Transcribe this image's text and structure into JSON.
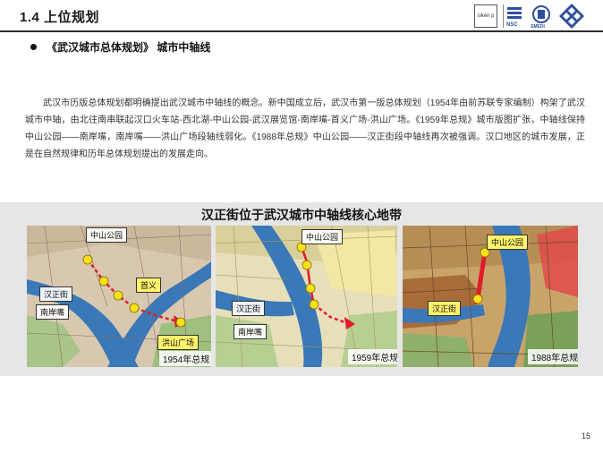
{
  "header": {
    "section_title": "1.4 上位规划",
    "logos": [
      "siken-logo",
      "nsc-logo",
      "smedi-logo",
      "diamond-logo"
    ],
    "logo_texts": {
      "siken": "siken p",
      "nsc": "NSC",
      "smedi": "SMEDI"
    }
  },
  "bullet": {
    "text": "《武汉城市总体规划》 城市中轴线"
  },
  "body_paragraph": "武汉市历版总体规划都明确提出武汉城市中轴线的概念。新中国成立后，武汉市第一版总体规划（1954年由前苏联专家编制）构架了武汉城市中轴，由北往南串联起汉口火车站-西北湖-中山公园-武汉展览馆-南岸嘴-首义广场-洪山广场。《1959年总规》城市版图扩张，中轴线保持中山公园——南岸嘴，南岸嘴——洪山广场段轴线弱化。《1988年总规》中山公园——汉正街段中轴线再次被强调。汉口地区的城市发展，正是在自然规律和历年总体规划提出的发展走向。",
  "band": {
    "title": "汉正街位于武汉城市中轴线核心地带"
  },
  "maps": [
    {
      "name": "map-1954",
      "year_label": "1954年总规",
      "labels": {
        "zhongshan": "中山公园",
        "hanzhengjie": "汉正街",
        "nananzui": "南岸嘴",
        "shouyi": "首义",
        "hongshan": "洪山广场"
      }
    },
    {
      "name": "map-1959",
      "year_label": "1959年总规",
      "labels": {
        "zhongshan": "中山公园",
        "hanzhengjie": "汉正街",
        "nananzui": "南岸嘴"
      }
    },
    {
      "name": "map-1988",
      "year_label": "1988年总规",
      "labels": {
        "zhongshan": "中山公园",
        "hanzhengjie": "汉正街"
      }
    }
  ],
  "colors": {
    "axis_red": "#e21b2a",
    "marker_yellow": "#f7e11a",
    "river_blue": "#3a78b8",
    "label_yellow": "#fff36b"
  },
  "page_number": "15"
}
